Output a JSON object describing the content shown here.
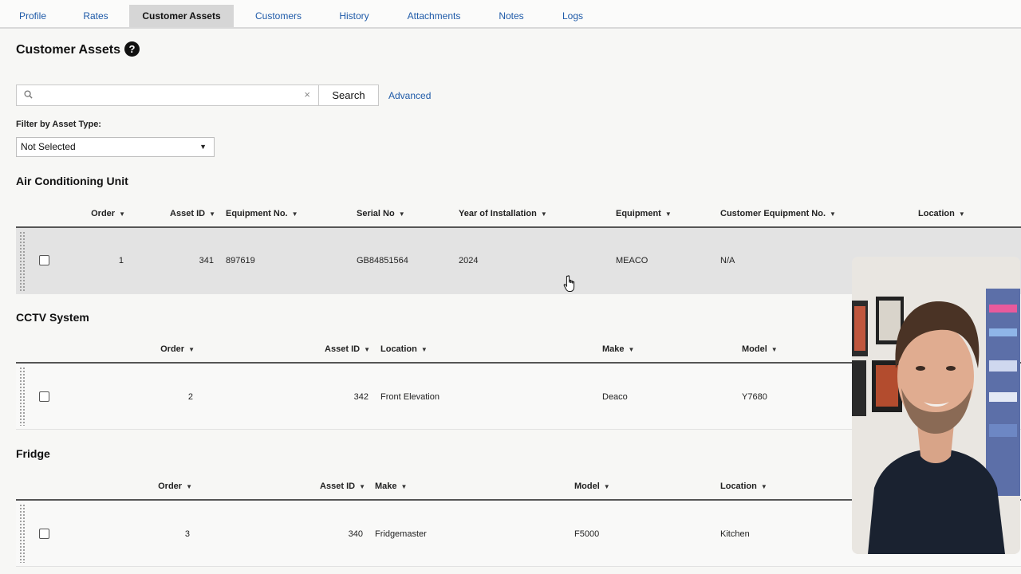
{
  "tabs": [
    {
      "label": "Profile"
    },
    {
      "label": "Rates"
    },
    {
      "label": "Customer Assets",
      "active": true
    },
    {
      "label": "Customers"
    },
    {
      "label": "History"
    },
    {
      "label": "Attachments"
    },
    {
      "label": "Notes"
    },
    {
      "label": "Logs"
    }
  ],
  "page": {
    "title": "Customer Assets",
    "help_icon": "question-circle-icon",
    "help_glyph": "?"
  },
  "search": {
    "placeholder": "",
    "value": "",
    "clear_glyph": "×",
    "button_label": "Search",
    "advanced_label": "Advanced"
  },
  "filter": {
    "label": "Filter by Asset Type:",
    "selected": "Not Selected",
    "arrow": "▼"
  },
  "sections": [
    {
      "title": "Air Conditioning Unit",
      "columns": [
        "Order",
        "Asset ID",
        "Equipment No.",
        "Serial No",
        "Year of Installation",
        "Equipment",
        "Customer Equipment No.",
        "Location"
      ],
      "rows": [
        {
          "order": "1",
          "asset_id": "341",
          "equipment_no": "897619",
          "serial_no": "GB84851564",
          "year": "2024",
          "equipment": "MEACO",
          "customer_equipment_no": "N/A",
          "location": ""
        }
      ]
    },
    {
      "title": "CCTV System",
      "columns": [
        "Order",
        "Asset ID",
        "Location",
        "Make",
        "Model"
      ],
      "rows": [
        {
          "order": "2",
          "asset_id": "342",
          "location": "Front Elevation",
          "make": "Deaco",
          "model": "Y7680"
        }
      ]
    },
    {
      "title": "Fridge",
      "columns": [
        "Order",
        "Asset ID",
        "Make",
        "Model",
        "Location"
      ],
      "rows": [
        {
          "order": "3",
          "asset_id": "340",
          "make": "Fridgemaster",
          "model": "F5000",
          "location": "Kitchen"
        }
      ]
    }
  ],
  "sort_glyph": "▼",
  "colors": {
    "link": "#1e5aa8",
    "active_tab_bg": "#d6d6d6",
    "selected_row_bg": "#e3e3e3"
  }
}
